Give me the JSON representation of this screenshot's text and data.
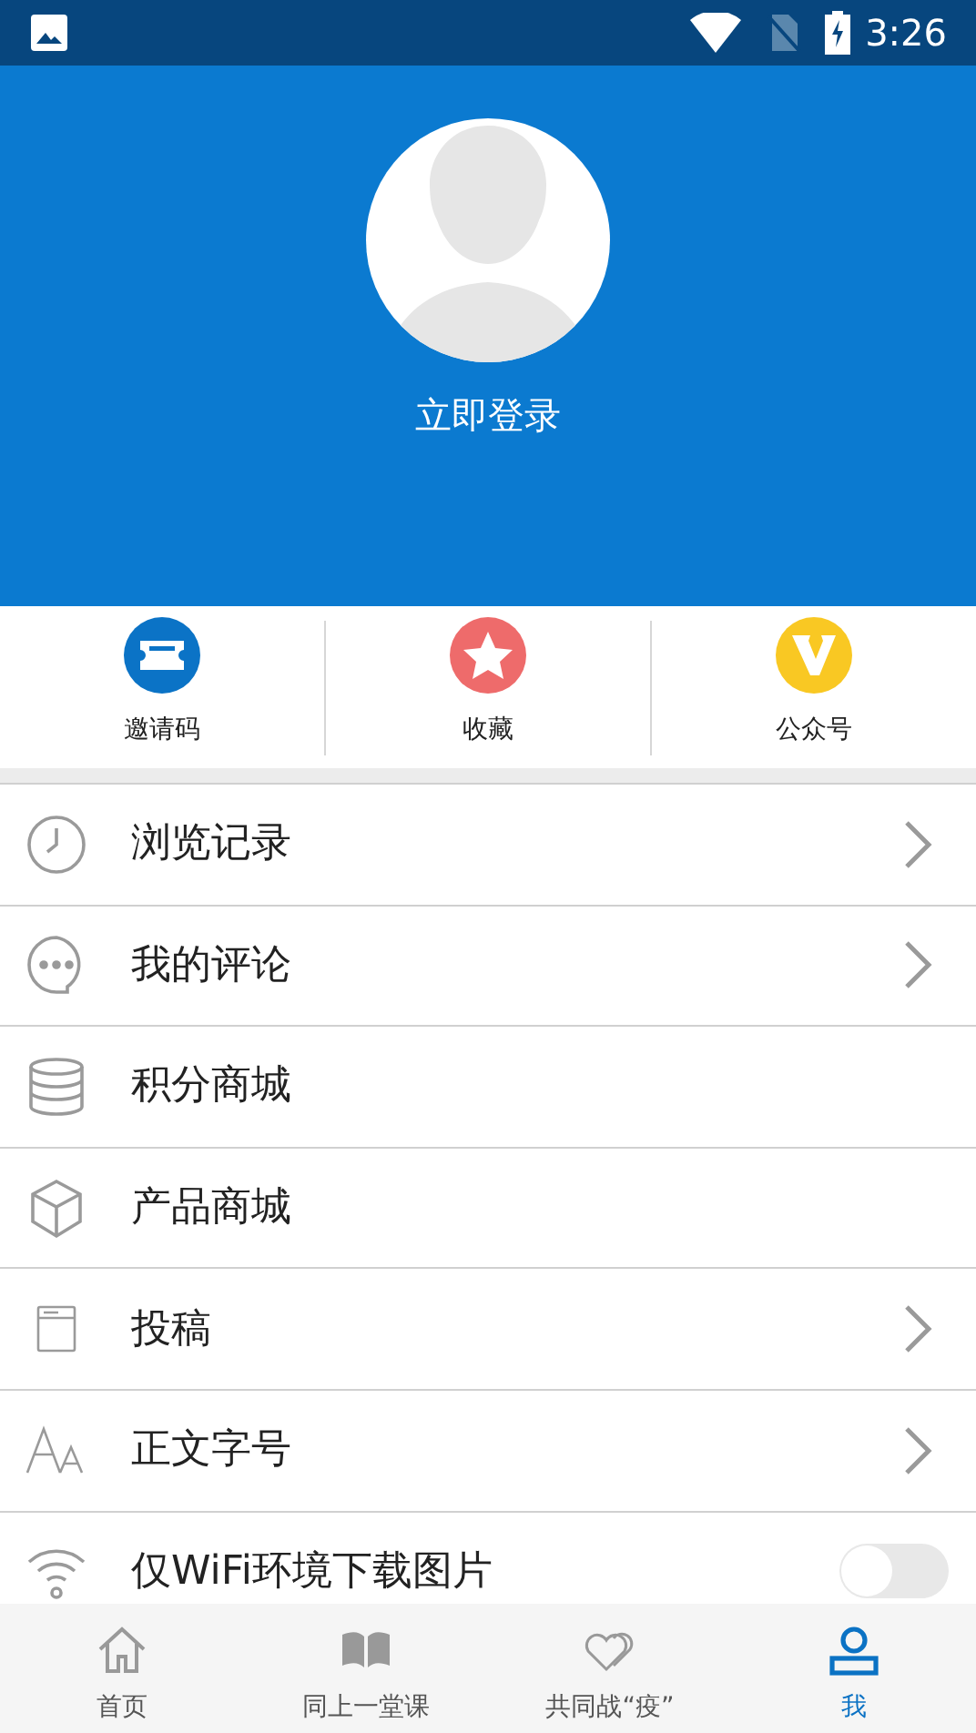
{
  "status_bar": {
    "time": "3:26"
  },
  "profile": {
    "login": "立即登录"
  },
  "shortcuts": [
    {
      "label": "邀请码"
    },
    {
      "label": "收藏"
    },
    {
      "label": "公众号"
    }
  ],
  "menu": [
    {
      "kind": "link",
      "label": "浏览记录"
    },
    {
      "kind": "link",
      "label": "我的评论"
    },
    {
      "kind": "plain",
      "label": "积分商城"
    },
    {
      "kind": "plain",
      "label": "产品商城"
    },
    {
      "kind": "link",
      "label": "投稿"
    },
    {
      "kind": "link",
      "label": "正文字号"
    },
    {
      "kind": "toggle",
      "label": "仅WiFi环境下载图片",
      "on": false
    }
  ],
  "bottom_nav": [
    {
      "label": "首页",
      "selected": false
    },
    {
      "label": "同上一堂课",
      "selected": false
    },
    {
      "label": "共同战“疫”",
      "selected": false
    },
    {
      "label": "我",
      "selected": true
    }
  ]
}
